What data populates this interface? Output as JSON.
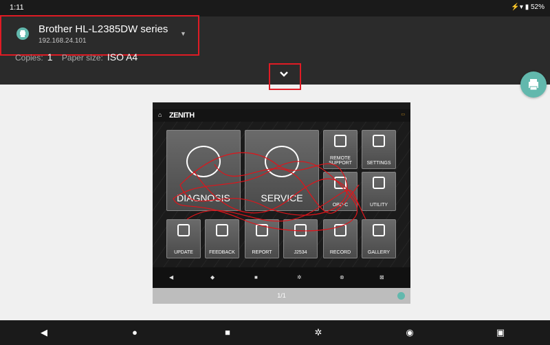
{
  "status_bar": {
    "time": "1:11",
    "battery": "52%"
  },
  "printer": {
    "name": "Brother HL-L2385DW series",
    "ip": "192.168.24.101"
  },
  "print_settings": {
    "copies_label": "Copies:",
    "copies_value": "1",
    "paper_label": "Paper size:",
    "paper_value": "ISO A4"
  },
  "preview": {
    "logo": "ZENITH",
    "big_tiles": [
      "DIAGNOSIS",
      "SERVICE"
    ],
    "small_tiles": [
      "REMOTE SUPPORT",
      "SETTINGS",
      "OBD-C",
      "UTILITY"
    ],
    "bottom_tiles": [
      "UPDATE",
      "FEEDBACK",
      "REPORT",
      "J2534",
      "RECORD",
      "GALLERY"
    ],
    "page_indicator": "1/1"
  },
  "colors": {
    "accent": "#62b8ad",
    "highlight": "#e01b24",
    "toolbar": "#2b2b2b"
  },
  "icons": {
    "printer": "printer-icon",
    "expand": "chevron-down-icon",
    "fab": "print-icon"
  }
}
